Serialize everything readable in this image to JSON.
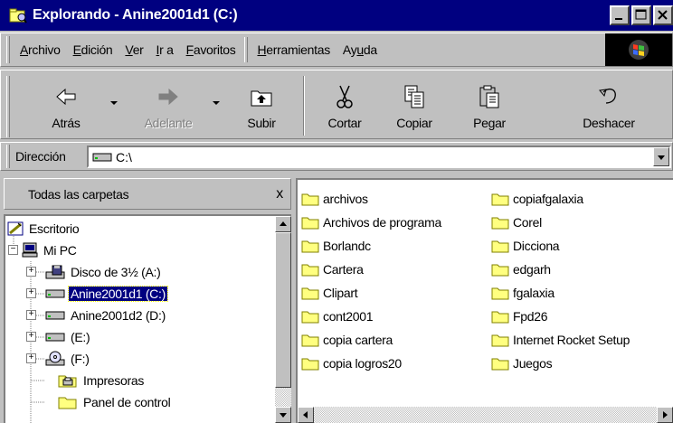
{
  "window": {
    "title": "Explorando - Anine2001d1 (C:)",
    "controls": [
      "_",
      "□",
      "X"
    ]
  },
  "menubar": {
    "items": [
      {
        "pre": "",
        "key": "A",
        "post": "rchivo"
      },
      {
        "pre": "",
        "key": "E",
        "post": "dición"
      },
      {
        "pre": "",
        "key": "V",
        "post": "er"
      },
      {
        "pre": "",
        "key": "I",
        "post": "r a"
      },
      {
        "pre": "",
        "key": "F",
        "post": "avoritos"
      },
      {
        "pre": "",
        "key": "H",
        "post": "erramientas"
      },
      {
        "pre": "Ay",
        "key": "u",
        "post": "da"
      }
    ]
  },
  "toolbar": {
    "back": "Atrás",
    "forward": "Adelante",
    "up": "Subir",
    "cut": "Cortar",
    "copy": "Copiar",
    "paste": "Pegar",
    "undo": "Deshacer"
  },
  "address": {
    "label": "Dirección",
    "value": "C:\\"
  },
  "leftpane": {
    "header": "Todas las carpetas",
    "close": "x",
    "tree": [
      {
        "label": "Escritorio",
        "icon": "desktop-icon"
      },
      {
        "label": "Mi PC",
        "icon": "my-computer-icon"
      },
      {
        "label": "Disco de 3½ (A:)",
        "icon": "floppy-icon"
      },
      {
        "label": "Anine2001d1 (C:)",
        "icon": "hard-drive-icon",
        "selected": true
      },
      {
        "label": "Anine2001d2 (D:)",
        "icon": "hard-drive-icon"
      },
      {
        "label": "(E:)",
        "icon": "hard-drive-icon"
      },
      {
        "label": "(F:)",
        "icon": "cd-drive-icon"
      },
      {
        "label": "Impresoras",
        "icon": "printers-folder-icon"
      },
      {
        "label": "Panel de control",
        "icon": "control-panel-icon"
      }
    ]
  },
  "files": {
    "col1": [
      "archivos",
      "Archivos de programa",
      "Borlandc",
      "Cartera",
      "Clipart",
      "cont2001",
      "copia cartera",
      "copia logros20"
    ],
    "col2": [
      "copiafgalaxia",
      "Corel",
      "Dicciona",
      "edgarh",
      "fgalaxia",
      "Fpd26",
      "Internet Rocket Setup",
      "Juegos"
    ]
  },
  "colors": {
    "titlebar": "#000080",
    "face": "#c0c0c0",
    "selection": "#000080",
    "folder": "#ffff80"
  }
}
